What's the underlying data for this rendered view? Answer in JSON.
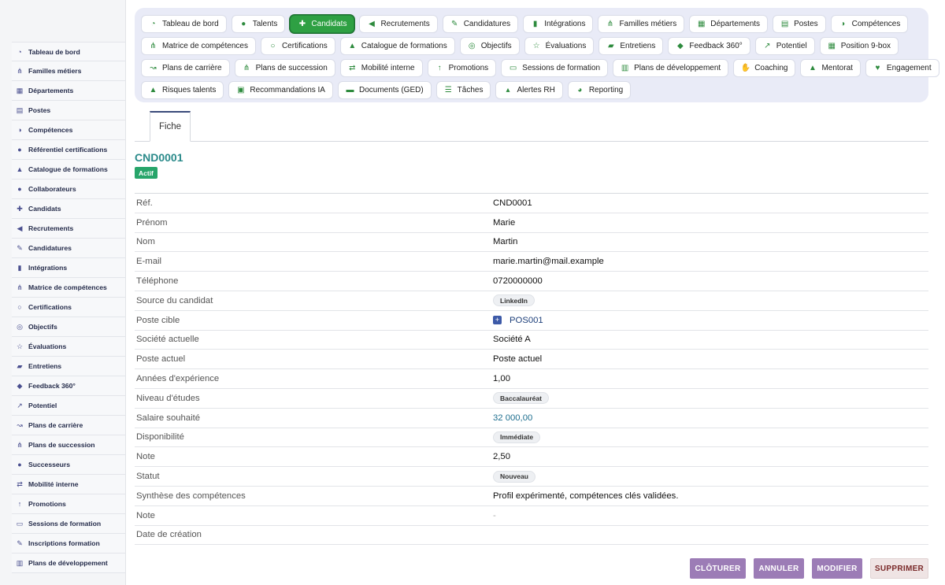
{
  "sidebar": {
    "items": [
      {
        "label": "Tableau de bord",
        "icon": "dashboard-icon"
      },
      {
        "label": "Familles métiers",
        "icon": "hierarchy-icon"
      },
      {
        "label": "Départements",
        "icon": "building-icon"
      },
      {
        "label": "Postes",
        "icon": "document-icon"
      },
      {
        "label": "Compétences",
        "icon": "brain-icon"
      },
      {
        "label": "Référentiel certifications",
        "icon": "certificate-icon"
      },
      {
        "label": "Catalogue de formations",
        "icon": "graduation-cap-icon"
      },
      {
        "label": "Collaborateurs",
        "icon": "user-icon"
      },
      {
        "label": "Candidats",
        "icon": "user-plus-icon"
      },
      {
        "label": "Recrutements",
        "icon": "megaphone-icon"
      },
      {
        "label": "Candidatures",
        "icon": "file-edit-icon"
      },
      {
        "label": "Intégrations",
        "icon": "door-icon"
      },
      {
        "label": "Matrice de compétences",
        "icon": "hierarchy-icon"
      },
      {
        "label": "Certifications",
        "icon": "award-icon"
      },
      {
        "label": "Objectifs",
        "icon": "target-icon"
      },
      {
        "label": "Évaluations",
        "icon": "star-icon"
      },
      {
        "label": "Entretiens",
        "icon": "comments-icon"
      },
      {
        "label": "Feedback 360°",
        "icon": "comment-icon"
      },
      {
        "label": "Potentiel",
        "icon": "chart-line-icon"
      },
      {
        "label": "Plans de carrière",
        "icon": "route-icon"
      },
      {
        "label": "Plans de succession",
        "icon": "hierarchy-icon"
      },
      {
        "label": "Successeurs",
        "icon": "users-icon"
      },
      {
        "label": "Mobilité interne",
        "icon": "exchange-icon"
      },
      {
        "label": "Promotions",
        "icon": "arrow-up-icon"
      },
      {
        "label": "Sessions de formation",
        "icon": "presentation-icon"
      },
      {
        "label": "Inscriptions formation",
        "icon": "user-edit-icon"
      },
      {
        "label": "Plans de développement",
        "icon": "clipboard-icon"
      }
    ]
  },
  "nav": {
    "rows": [
      [
        {
          "label": "Tableau de bord",
          "icon": "dashboard-icon"
        },
        {
          "label": "Talents",
          "icon": "user-icon"
        },
        {
          "label": "Candidats",
          "icon": "user-plus-icon",
          "active": true
        },
        {
          "label": "Recrutements",
          "icon": "megaphone-icon"
        },
        {
          "label": "Candidatures",
          "icon": "file-edit-icon"
        },
        {
          "label": "Intégrations",
          "icon": "door-icon"
        },
        {
          "label": "Familles métiers",
          "icon": "hierarchy-icon"
        },
        {
          "label": "Départements",
          "icon": "building-icon"
        },
        {
          "label": "Postes",
          "icon": "document-icon"
        },
        {
          "label": "Compétences",
          "icon": "brain-icon"
        }
      ],
      [
        {
          "label": "Matrice de compétences",
          "icon": "hierarchy-icon"
        },
        {
          "label": "Certifications",
          "icon": "award-icon"
        },
        {
          "label": "Catalogue de formations",
          "icon": "graduation-cap-icon"
        },
        {
          "label": "Objectifs",
          "icon": "target-icon"
        },
        {
          "label": "Évaluations",
          "icon": "star-icon"
        },
        {
          "label": "Entretiens",
          "icon": "comments-icon"
        },
        {
          "label": "Feedback 360°",
          "icon": "comment-icon"
        },
        {
          "label": "Potentiel",
          "icon": "chart-line-icon"
        },
        {
          "label": "Position 9-box",
          "icon": "grid-icon"
        }
      ],
      [
        {
          "label": "Plans de carrière",
          "icon": "route-icon"
        },
        {
          "label": "Plans de succession",
          "icon": "hierarchy-icon"
        },
        {
          "label": "Mobilité interne",
          "icon": "exchange-icon"
        },
        {
          "label": "Promotions",
          "icon": "arrow-up-icon"
        },
        {
          "label": "Sessions de formation",
          "icon": "presentation-icon"
        },
        {
          "label": "Plans de développement",
          "icon": "clipboard-icon"
        },
        {
          "label": "Coaching",
          "icon": "handshake-icon"
        },
        {
          "label": "Mentorat",
          "icon": "mentor-icon"
        },
        {
          "label": "Engagement",
          "icon": "heart-icon"
        }
      ],
      [
        {
          "label": "Risques talents",
          "icon": "warning-icon"
        },
        {
          "label": "Recommandations IA",
          "icon": "robot-icon"
        },
        {
          "label": "Documents (GED)",
          "icon": "folder-icon"
        },
        {
          "label": "Tâches",
          "icon": "tasks-icon"
        },
        {
          "label": "Alertes RH",
          "icon": "bell-icon"
        },
        {
          "label": "Reporting",
          "icon": "pie-chart-icon"
        }
      ]
    ]
  },
  "tabs": {
    "fiche": "Fiche"
  },
  "record": {
    "code": "CND0001",
    "status_badge": "Actif"
  },
  "fields": [
    {
      "label": "Réf.",
      "value": "CND0001",
      "kind": "text"
    },
    {
      "label": "Prénom",
      "value": "Marie",
      "kind": "text"
    },
    {
      "label": "Nom",
      "value": "Martin",
      "kind": "text"
    },
    {
      "label": "E-mail",
      "value": "marie.martin@mail.example",
      "kind": "text"
    },
    {
      "label": "Téléphone",
      "value": "0720000000",
      "kind": "text"
    },
    {
      "label": "Source du candidat",
      "value": "LinkedIn",
      "kind": "pill"
    },
    {
      "label": "Poste cible",
      "value": "POS001",
      "kind": "link"
    },
    {
      "label": "Société actuelle",
      "value": "Société A",
      "kind": "text"
    },
    {
      "label": "Poste actuel",
      "value": "Poste actuel",
      "kind": "text"
    },
    {
      "label": "Années d'expérience",
      "value": "1,00",
      "kind": "text"
    },
    {
      "label": "Niveau d'études",
      "value": "Baccalauréat",
      "kind": "pill"
    },
    {
      "label": "Salaire souhaité",
      "value": "32 000,00",
      "kind": "money"
    },
    {
      "label": "Disponibilité",
      "value": "Immédiate",
      "kind": "pill"
    },
    {
      "label": "Note",
      "value": "2,50",
      "kind": "text"
    },
    {
      "label": "Statut",
      "value": "Nouveau",
      "kind": "pill"
    },
    {
      "label": "Synthèse des compétences",
      "value": "Profil expérimenté, compétences clés validées.",
      "kind": "text"
    },
    {
      "label": "Note",
      "value": "-",
      "kind": "muted"
    },
    {
      "label": "Date de création",
      "value": "",
      "kind": "text"
    }
  ],
  "actions": {
    "close": "CLÔTURER",
    "cancel": "ANNULER",
    "edit": "MODIFIER",
    "delete": "SUPPRIMER"
  },
  "colors": {
    "accent": "#2ea043",
    "title": "#2a8a8a",
    "action": "#9c7cb6"
  }
}
